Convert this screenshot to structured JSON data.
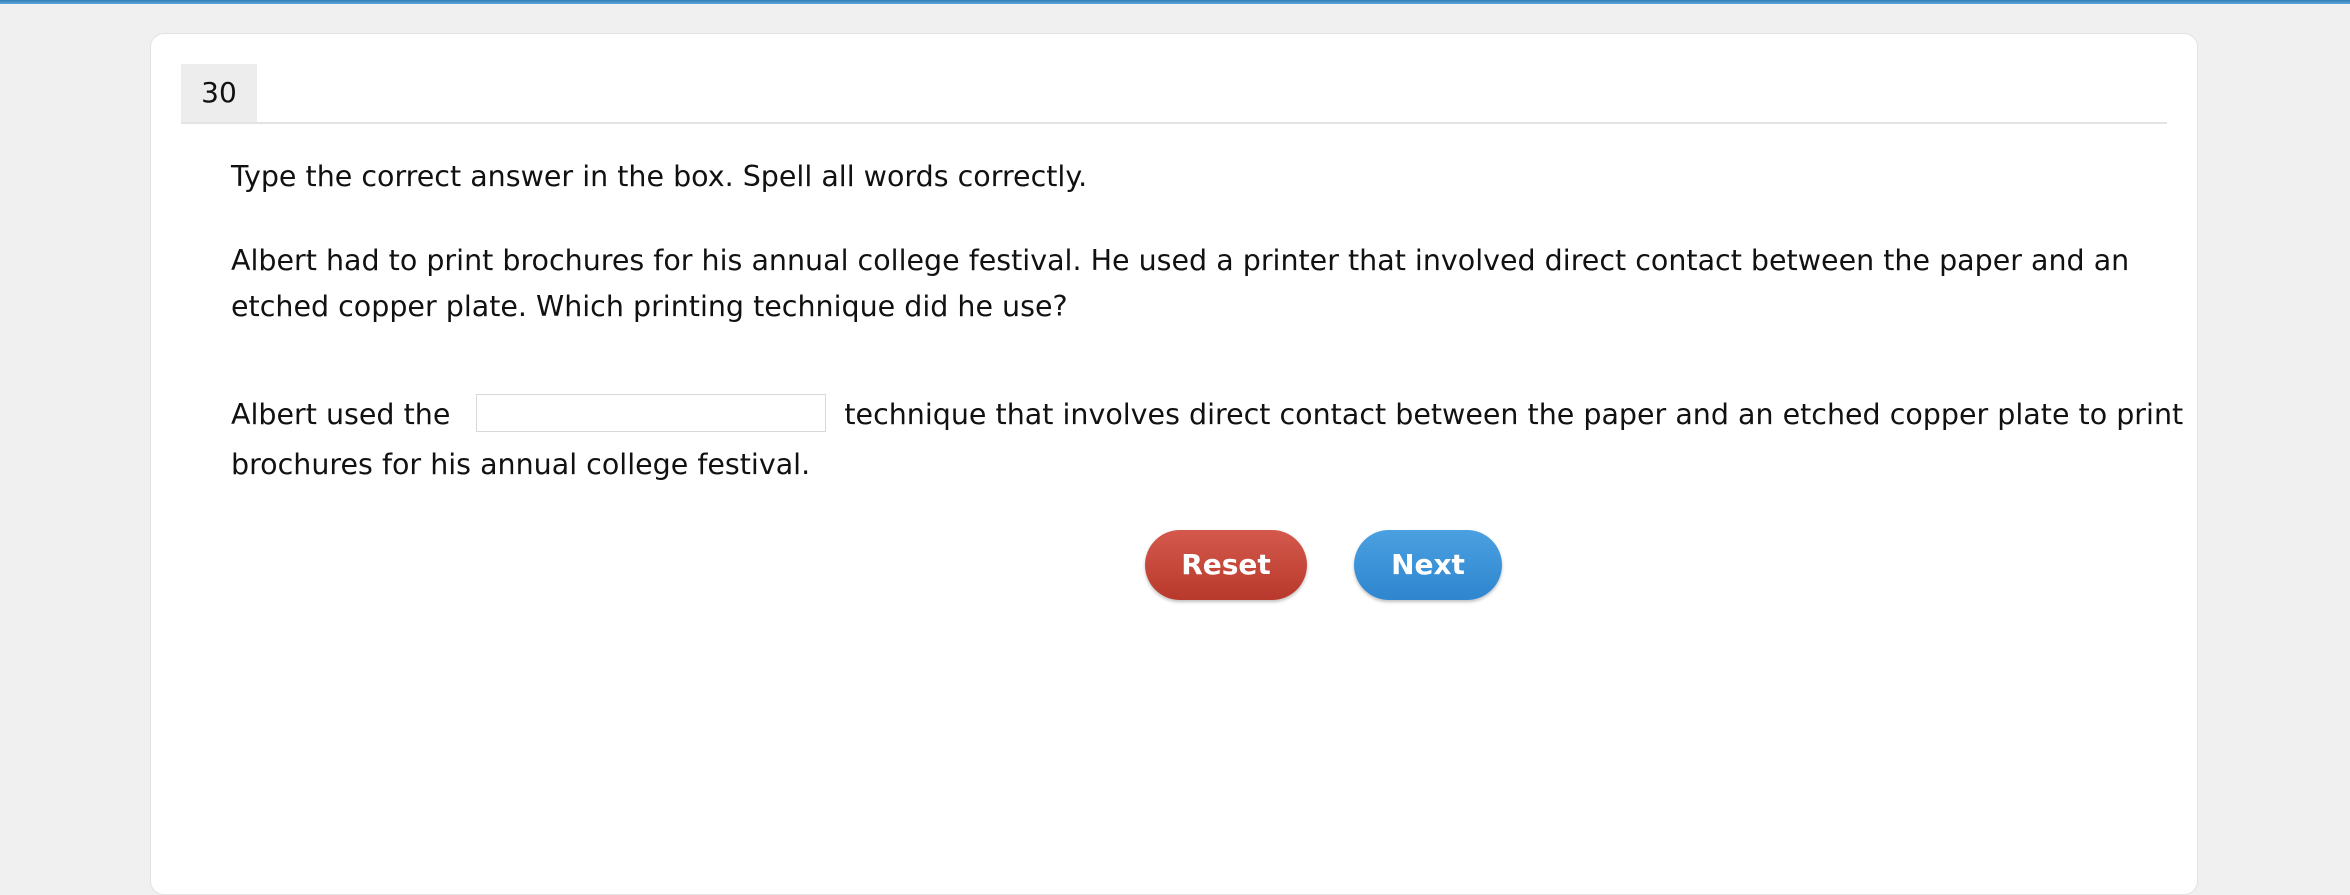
{
  "question": {
    "number": "30",
    "instruction": "Type the correct answer in the box. Spell all words correctly.",
    "prompt": "Albert had to print brochures for his annual college festival. He used a printer that involved direct contact between the paper and an etched copper plate. Which printing technique did he use?",
    "answer_prefix": "Albert used the",
    "answer_value": "",
    "answer_suffix_line1": "technique that involves direct contact between the paper and an etched copper plate to print",
    "answer_suffix_line2": "brochures for his annual college festival."
  },
  "buttons": {
    "reset_label": "Reset",
    "next_label": "Next"
  },
  "colors": {
    "reset": "#c9473a",
    "next": "#3b93d9",
    "top_bar": "#3a8cc6"
  }
}
